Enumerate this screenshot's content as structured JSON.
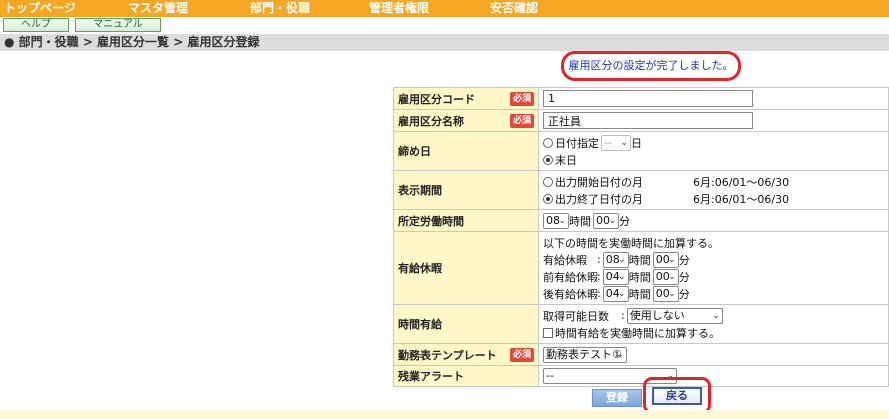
{
  "nav": {
    "items": [
      "トップページ",
      "マスタ管理",
      "部門・役職",
      "管理者権限",
      "安否確認"
    ]
  },
  "subnav": {
    "help": "ヘルプ",
    "manual": "マニュアル"
  },
  "breadcrumb": "● 部門・役職 > 雇用区分一覧 > 雇用区分登録",
  "message": "雇用区分の設定が完了しました。",
  "required_badge": "必須",
  "form": {
    "code": {
      "label": "雇用区分コード",
      "value": "1"
    },
    "name": {
      "label": "雇用区分名称",
      "value": "正社員"
    },
    "closing": {
      "label": "締め日",
      "opt1": "日付指定",
      "day_select": "--",
      "day_unit": "日",
      "opt2": "末日"
    },
    "display_period": {
      "label": "表示期間",
      "opt1": "出力開始日付の月",
      "opt1_range": "6月:06/01～06/30",
      "opt2": "出力終了日付の月",
      "opt2_range": "6月:06/01～06/30"
    },
    "work_hours": {
      "label": "所定労働時間",
      "hour": "08",
      "hour_unit": "時間",
      "min": "00",
      "min_unit": "分"
    },
    "paid_leave": {
      "label": "有給休暇",
      "desc": "以下の時間を実働時間に加算する。",
      "rows": [
        {
          "name": "有給休暇",
          "hour": "08",
          "min": "00"
        },
        {
          "name": "前有給休暇",
          "hour": "04",
          "min": "00"
        },
        {
          "name": "後有給休暇",
          "hour": "04",
          "min": "00"
        }
      ],
      "sep": ":",
      "hour_unit": "時間",
      "min_unit": "分"
    },
    "hourly_leave": {
      "label": "時間有給",
      "days_label": "取得可能日数",
      "sep": ":",
      "days_value": "使用しない",
      "checkbox_label": "時間有給を実働時間に加算する。"
    },
    "template": {
      "label": "勤務表テンプレート",
      "value": "勤務表テスト①"
    },
    "overtime": {
      "label": "残業アラート",
      "value": "--"
    }
  },
  "buttons": {
    "register": "登録",
    "back": "戻る"
  },
  "colors": {
    "nav_bg": "#f5a623",
    "label_bg": "#fff7c8",
    "required": "#e04a3c",
    "highlight": "#e2222d",
    "message": "#1a34c8"
  }
}
